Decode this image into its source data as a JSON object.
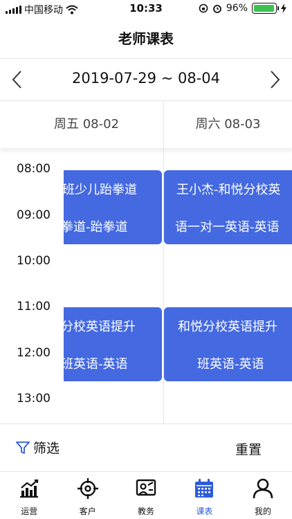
{
  "status_bar": {
    "carrier": "中国移动",
    "time": "10:33",
    "battery": "96%",
    "battery_level": 0.96
  },
  "header": {
    "title": "老师课表"
  },
  "week": {
    "range": "2019-07-29 ~ 08-04"
  },
  "days": [
    {
      "label": "周五 08-02"
    },
    {
      "label": "周六 08-03"
    }
  ],
  "times": [
    "08:00",
    "09:00",
    "10:00",
    "11:00",
    "12:00",
    "13:00"
  ],
  "events": {
    "fri": [
      {
        "line1": "班少儿跆拳道",
        "line2": "拳道-跆拳道"
      },
      {
        "line1": "分校英语提升",
        "line2": "班英语-英语"
      }
    ],
    "sat": [
      {
        "line1": "王小杰-和悦分校英",
        "line2": "语一对一英语-英语"
      },
      {
        "line1": "和悦分校英语提升",
        "line2": "班英语-英语"
      }
    ]
  },
  "filter": {
    "label": "筛选",
    "reset": "重置"
  },
  "tabs": [
    {
      "label": "运营",
      "icon": "chart-icon"
    },
    {
      "label": "客户",
      "icon": "target-icon"
    },
    {
      "label": "教务",
      "icon": "teaching-icon"
    },
    {
      "label": "课表",
      "icon": "calendar-icon"
    },
    {
      "label": "我的",
      "icon": "person-icon"
    }
  ],
  "colors": {
    "event_blue": "#4469e0",
    "active_tab": "#2f5bd6",
    "battery_green": "#3dc24f"
  }
}
